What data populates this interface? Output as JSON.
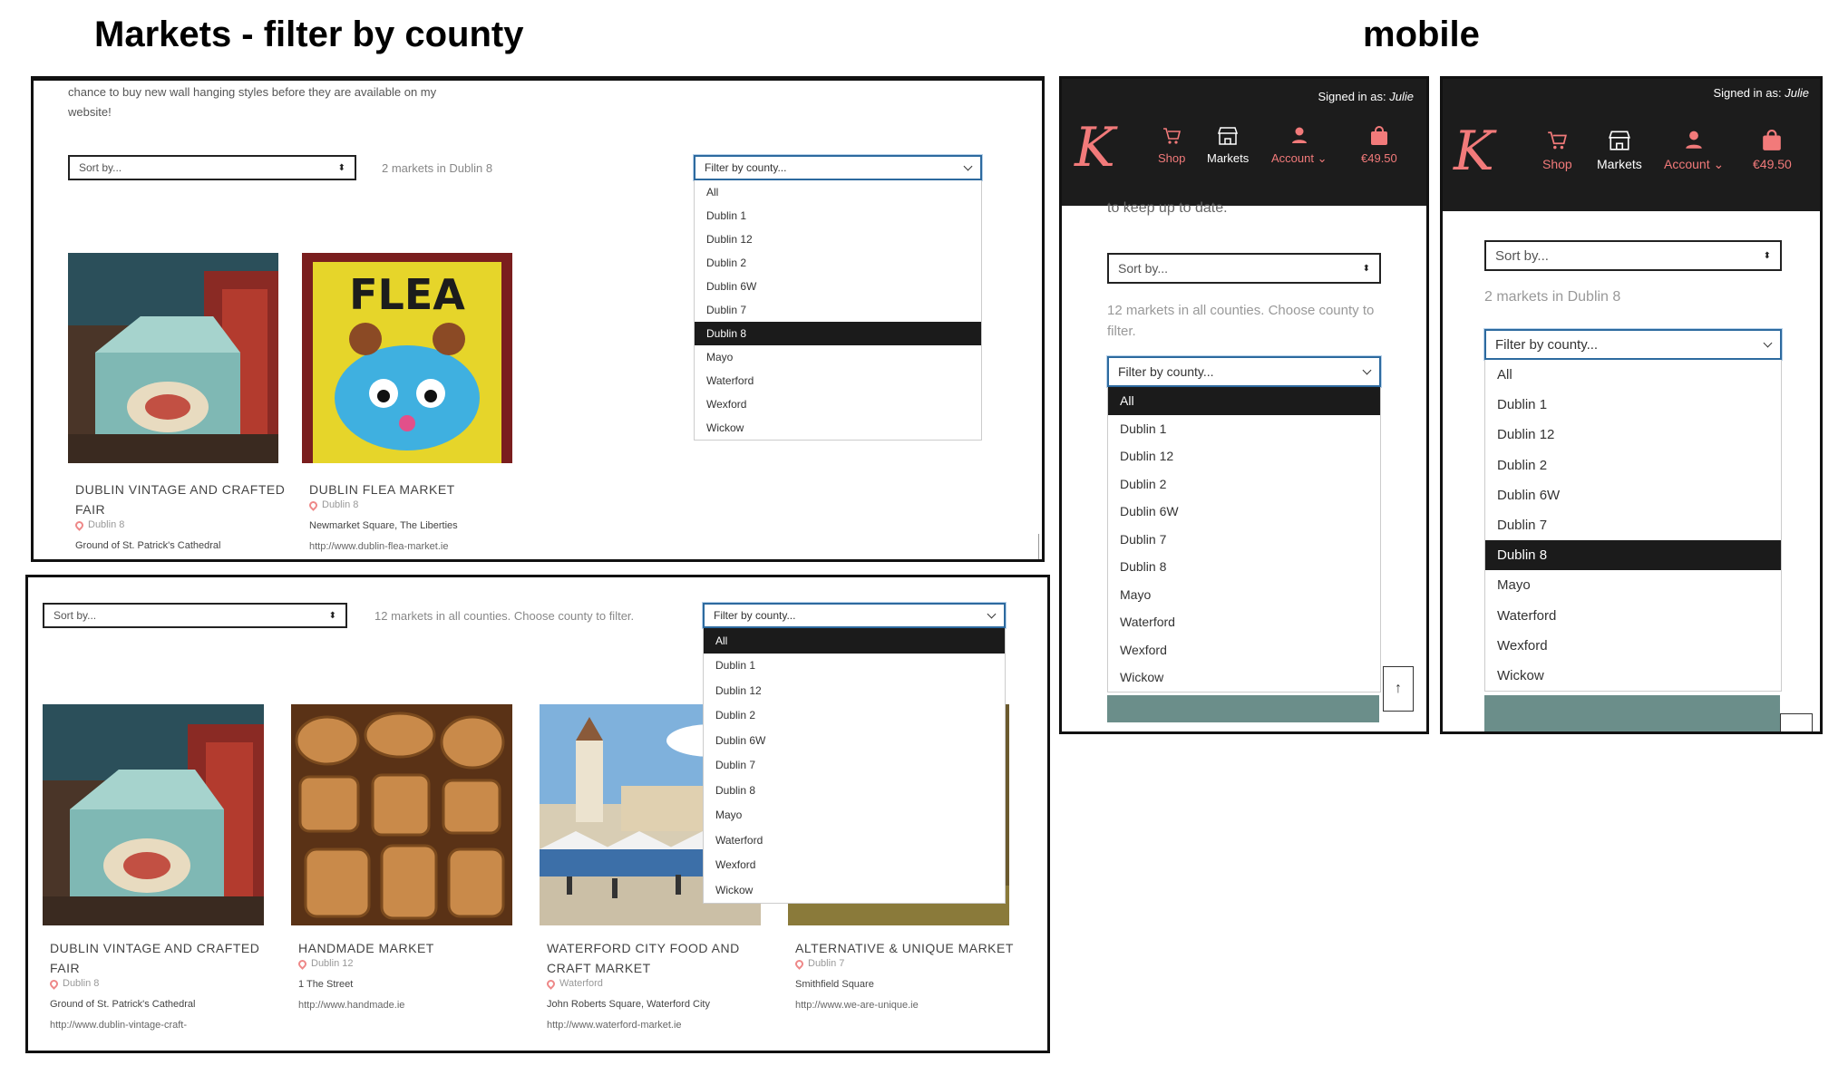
{
  "headings": {
    "desktop": "Markets - filter by county",
    "mobile": "mobile"
  },
  "counties": [
    "All",
    "Dublin 1",
    "Dublin 12",
    "Dublin 2",
    "Dublin 6W",
    "Dublin 7",
    "Dublin 8",
    "Mayo",
    "Waterford",
    "Wexford",
    "Wickow"
  ],
  "desktop_top": {
    "intro_line1": "chance to buy new wall hanging styles before they are available on my",
    "intro_line2": "website!",
    "sort_placeholder": "Sort by...",
    "count_text": "2 markets in Dublin 8",
    "filter_placeholder": "Filter by county...",
    "selected": "Dublin 8",
    "cards": [
      {
        "title_l1": "DUBLIN VINTAGE AND CRAFTED",
        "title_l2": "FAIR",
        "county": "Dublin 8",
        "address": "Ground of St. Patrick's Cathedral",
        "url": ""
      },
      {
        "title_l1": "DUBLIN FLEA MARKET",
        "title_l2": "",
        "county": "Dublin 8",
        "address": "Newmarket Square, The Liberties",
        "url": "http://www.dublin-flea-market.ie"
      }
    ]
  },
  "desktop_bottom": {
    "sort_placeholder": "Sort by...",
    "count_text": "12 markets in all counties. Choose county to filter.",
    "filter_placeholder": "Filter by county...",
    "selected": "All",
    "cards": [
      {
        "title_l1": "DUBLIN VINTAGE AND CRAFTED",
        "title_l2": "FAIR",
        "county": "Dublin 8",
        "address": "Ground of St. Patrick's Cathedral",
        "url": "http://www.dublin-vintage-craft-"
      },
      {
        "title_l1": "HANDMADE MARKET",
        "title_l2": "",
        "county": "Dublin 12",
        "address": "1 The Street",
        "url": "http://www.handmade.ie"
      },
      {
        "title_l1": "WATERFORD CITY FOOD AND",
        "title_l2": "CRAFT MARKET",
        "county": "Waterford",
        "address": "John Roberts Square, Waterford City",
        "url": "http://www.waterford-market.ie"
      },
      {
        "title_l1": "ALTERNATIVE & UNIQUE MARKET",
        "title_l2": "",
        "county": "Dublin 7",
        "address": "Smithfield Square",
        "url": "http://www.we-are-unique.ie"
      }
    ]
  },
  "mobile_header": {
    "signed_in_label": "Signed in as:",
    "user": "Julie",
    "logo": "K",
    "nav": {
      "shop": "Shop",
      "markets": "Markets",
      "account": "Account",
      "cart": "€49.50"
    }
  },
  "mobile1": {
    "partial_text": "to keep up to date.",
    "sort_placeholder": "Sort by...",
    "count_line1": "12 markets in all counties. Choose county to",
    "count_line2": "filter.",
    "filter_placeholder": "Filter by county...",
    "selected": "All",
    "scroll_top": "↑"
  },
  "mobile2": {
    "sort_placeholder": "Sort by...",
    "count_text": "2 markets in Dublin 8",
    "filter_placeholder": "Filter by county...",
    "selected": "Dublin 8"
  },
  "colors": {
    "accent": "#f27a7a",
    "dark": "#1c1c1c",
    "focus": "#2d6a9f"
  }
}
